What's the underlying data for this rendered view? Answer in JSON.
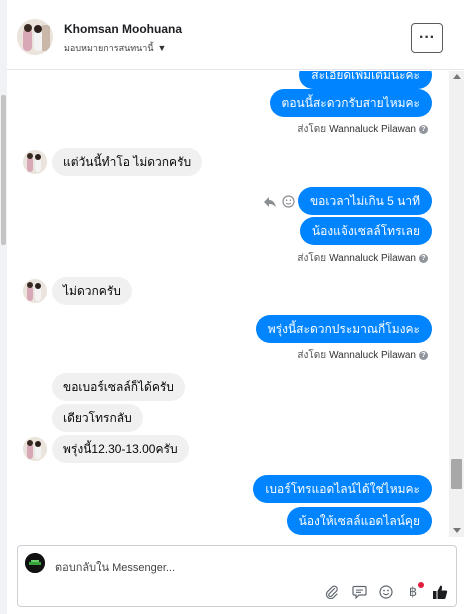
{
  "header": {
    "name": "Khomsan Moohuana",
    "assign_label": "มอบหมายการสนทนานี้",
    "more_label": "···"
  },
  "messages": {
    "out_partial": "สะเอียดเพิ่มเติมนะคะ",
    "out_1": "ตอนนี้สะดวกรับสายไหมคะ",
    "in_1": "แต่วันนี้ทำโอ  ไม่ดวกครับ",
    "out_2": "ขอเวลาไม่เกิน 5 นาที",
    "out_3": "น้องแจ้งเซลล์โทรเลย",
    "in_2": "ไม่ดวกครับ",
    "out_4": "พรุ่งนี้สะดวกประมาณกี่โมงคะ",
    "in_3": "ขอเบอร์เซลล์ก็ได้ครับ",
    "in_4": "เดียวโทรกลับ",
    "in_5": "พรุ่งนี้12.30-13.00ครับ",
    "out_5": "เบอร์โทรแอดไลน์ได้ใช่ไหมคะ",
    "out_6": "น้องให้เซลล์แอดไลน์คุย"
  },
  "sent_by": {
    "prefix": "ส่งโดย",
    "agent": "Wannaluck Pilawan",
    "help": "?"
  },
  "composer": {
    "placeholder": "ตอบกลับใน Messenger..."
  },
  "icons": {
    "attach": "paperclip-icon",
    "saved_reply": "speech-bubble-icon",
    "emoji": "smiley-icon",
    "payment": "baht-icon",
    "like": "thumbs-up-icon",
    "reply": "reply-arrow-icon",
    "react": "smiley-icon"
  },
  "colors": {
    "outgoing_bubble": "#0084ff",
    "incoming_bubble": "#f0f0f0",
    "notification_dot": "#e41e3f",
    "like": "#1c1e21"
  }
}
